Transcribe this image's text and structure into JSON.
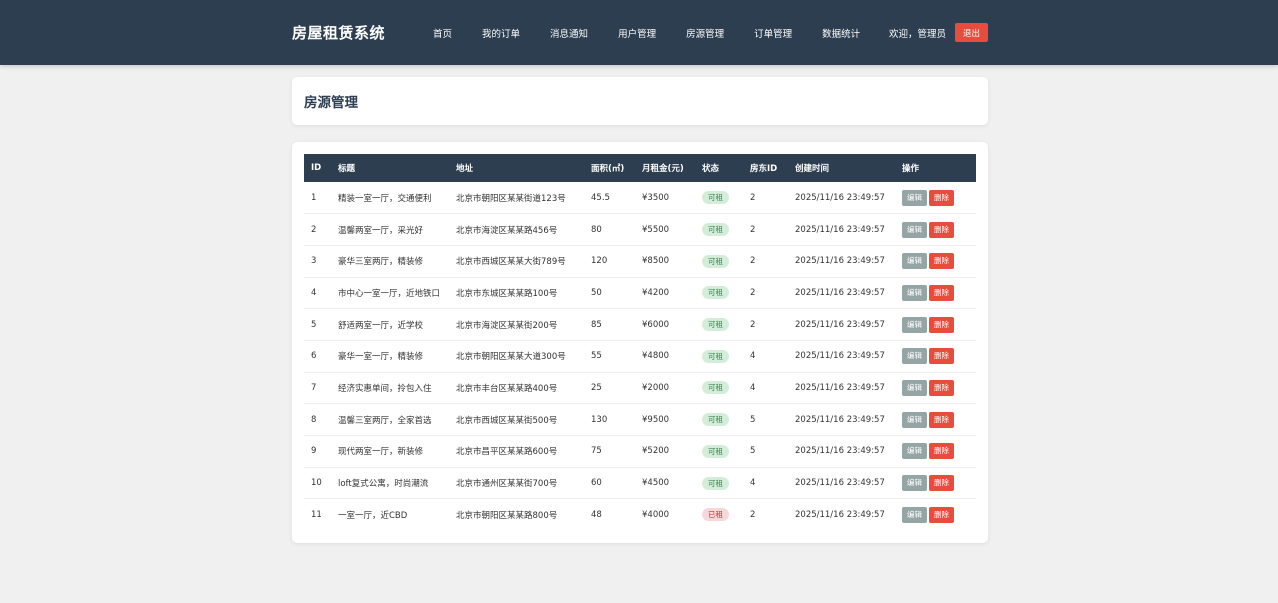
{
  "brand": "房屋租赁系统",
  "nav": [
    "首页",
    "我的订单",
    "消息通知",
    "用户管理",
    "房源管理",
    "订单管理",
    "数据统计"
  ],
  "welcome": "欢迎，管理员",
  "logout_label": "退出",
  "page_title": "房源管理",
  "colors": {
    "header": "#2c3e50",
    "danger": "#e74c3c",
    "edit": "#95a5a6",
    "available_bg": "#d4edda",
    "rented_bg": "#f8d7da"
  },
  "table": {
    "columns": [
      "ID",
      "标题",
      "地址",
      "面积(㎡)",
      "月租金(元)",
      "状态",
      "房东ID",
      "创建时间",
      "操作"
    ],
    "edit_label": "编辑",
    "delete_label": "删除",
    "rows": [
      {
        "id": "1",
        "title": "精装一室一厅，交通便利",
        "address": "北京市朝阳区某某街道123号",
        "area": "45.5",
        "rent": "¥3500",
        "status": "可租",
        "status_type": "ok",
        "landlord": "2",
        "created": "2025/11/16 23:49:57"
      },
      {
        "id": "2",
        "title": "温馨两室一厅，采光好",
        "address": "北京市海淀区某某路456号",
        "area": "80",
        "rent": "¥5500",
        "status": "可租",
        "status_type": "ok",
        "landlord": "2",
        "created": "2025/11/16 23:49:57"
      },
      {
        "id": "3",
        "title": "豪华三室两厅，精装修",
        "address": "北京市西城区某某大街789号",
        "area": "120",
        "rent": "¥8500",
        "status": "可租",
        "status_type": "ok",
        "landlord": "2",
        "created": "2025/11/16 23:49:57"
      },
      {
        "id": "4",
        "title": "市中心一室一厅，近地铁口",
        "address": "北京市东城区某某路100号",
        "area": "50",
        "rent": "¥4200",
        "status": "可租",
        "status_type": "ok",
        "landlord": "2",
        "created": "2025/11/16 23:49:57"
      },
      {
        "id": "5",
        "title": "舒适两室一厅，近学校",
        "address": "北京市海淀区某某街200号",
        "area": "85",
        "rent": "¥6000",
        "status": "可租",
        "status_type": "ok",
        "landlord": "2",
        "created": "2025/11/16 23:49:57"
      },
      {
        "id": "6",
        "title": "豪华一室一厅，精装修",
        "address": "北京市朝阳区某某大道300号",
        "area": "55",
        "rent": "¥4800",
        "status": "可租",
        "status_type": "ok",
        "landlord": "4",
        "created": "2025/11/16 23:49:57"
      },
      {
        "id": "7",
        "title": "经济实惠单间，拎包入住",
        "address": "北京市丰台区某某路400号",
        "area": "25",
        "rent": "¥2000",
        "status": "可租",
        "status_type": "ok",
        "landlord": "4",
        "created": "2025/11/16 23:49:57"
      },
      {
        "id": "8",
        "title": "温馨三室两厅，全家首选",
        "address": "北京市西城区某某街500号",
        "area": "130",
        "rent": "¥9500",
        "status": "可租",
        "status_type": "ok",
        "landlord": "5",
        "created": "2025/11/16 23:49:57"
      },
      {
        "id": "9",
        "title": "现代两室一厅，新装修",
        "address": "北京市昌平区某某路600号",
        "area": "75",
        "rent": "¥5200",
        "status": "可租",
        "status_type": "ok",
        "landlord": "5",
        "created": "2025/11/16 23:49:57"
      },
      {
        "id": "10",
        "title": "loft复式公寓，时尚潮流",
        "address": "北京市通州区某某街700号",
        "area": "60",
        "rent": "¥4500",
        "status": "可租",
        "status_type": "ok",
        "landlord": "4",
        "created": "2025/11/16 23:49:57"
      },
      {
        "id": "11",
        "title": "一室一厅，近CBD",
        "address": "北京市朝阳区某某路800号",
        "area": "48",
        "rent": "¥4000",
        "status": "已租",
        "status_type": "rented",
        "landlord": "2",
        "created": "2025/11/16 23:49:57"
      }
    ]
  }
}
